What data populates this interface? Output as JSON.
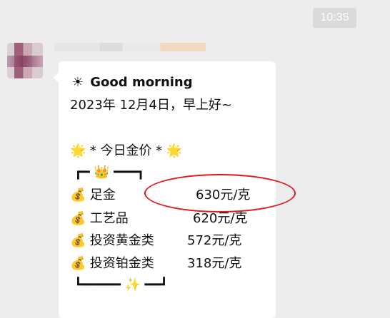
{
  "header": {
    "time": "10:35"
  },
  "message": {
    "greeting_icon": "☀",
    "greeting": "Good morning",
    "date_line": "2023年 12月4日，早上好~",
    "title_left_icon": "🌟",
    "title": "* 今日金价 *",
    "title_right_icon": "🌟",
    "frame_top_left": "┏━ ",
    "frame_top_icon": "👑",
    "frame_top_right": " ━━━┓",
    "rows": [
      {
        "icon": "💰",
        "name": "足金",
        "price": "630元/克"
      },
      {
        "icon": "💰",
        "name": "工艺品",
        "price": "620元/克"
      },
      {
        "icon": "💰",
        "name": "投资黄金类",
        "price": "572元/克"
      },
      {
        "icon": "💰",
        "name": "投资铂金类",
        "price": "318元/克"
      }
    ],
    "frame_bottom_left": "┗━━━━━ ",
    "frame_bottom_icon": "✨",
    "frame_bottom_right": " ━━┛"
  },
  "colors": {
    "highlight_circle": "#e0181f",
    "background": "#ededed",
    "bubble": "#ffffff"
  }
}
